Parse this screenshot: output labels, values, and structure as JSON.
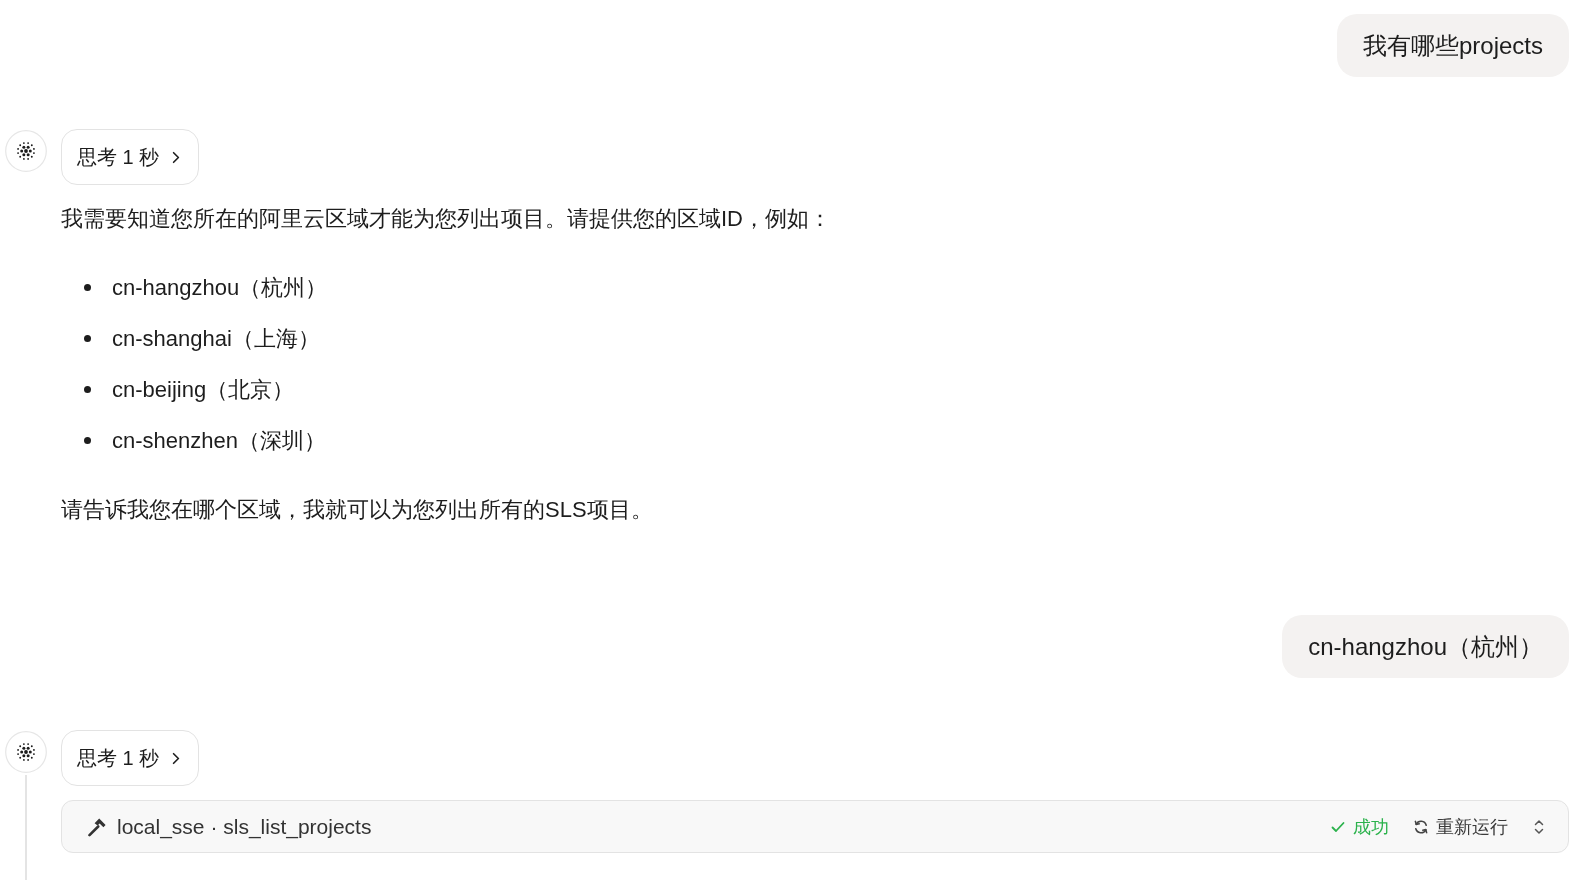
{
  "conversation": [
    {
      "kind": "user",
      "text": "我有哪些projects"
    },
    {
      "kind": "assistant",
      "thinking": {
        "label": "思考 1 秒",
        "expanded": false
      },
      "blocks": [
        {
          "kind": "paragraph",
          "text": "我需要知道您所在的阿里云区域才能为您列出项目。请提供您的区域ID，例如："
        },
        {
          "kind": "list",
          "items": [
            "cn-hangzhou（杭州）",
            "cn-shanghai（上海）",
            "cn-beijing（北京）",
            "cn-shenzhen（深圳）"
          ]
        },
        {
          "kind": "paragraph",
          "text": "请告诉我您在哪个区域，我就可以为您列出所有的SLS项目。"
        }
      ]
    },
    {
      "kind": "user",
      "text": "cn-hangzhou（杭州）"
    },
    {
      "kind": "assistant",
      "thinking": {
        "label": "思考 1 秒",
        "expanded": false
      },
      "tool_call": {
        "name": "local_sse · sls_list_projects",
        "status": {
          "kind": "success",
          "label": "成功"
        },
        "rerun": "重新运行"
      }
    }
  ]
}
